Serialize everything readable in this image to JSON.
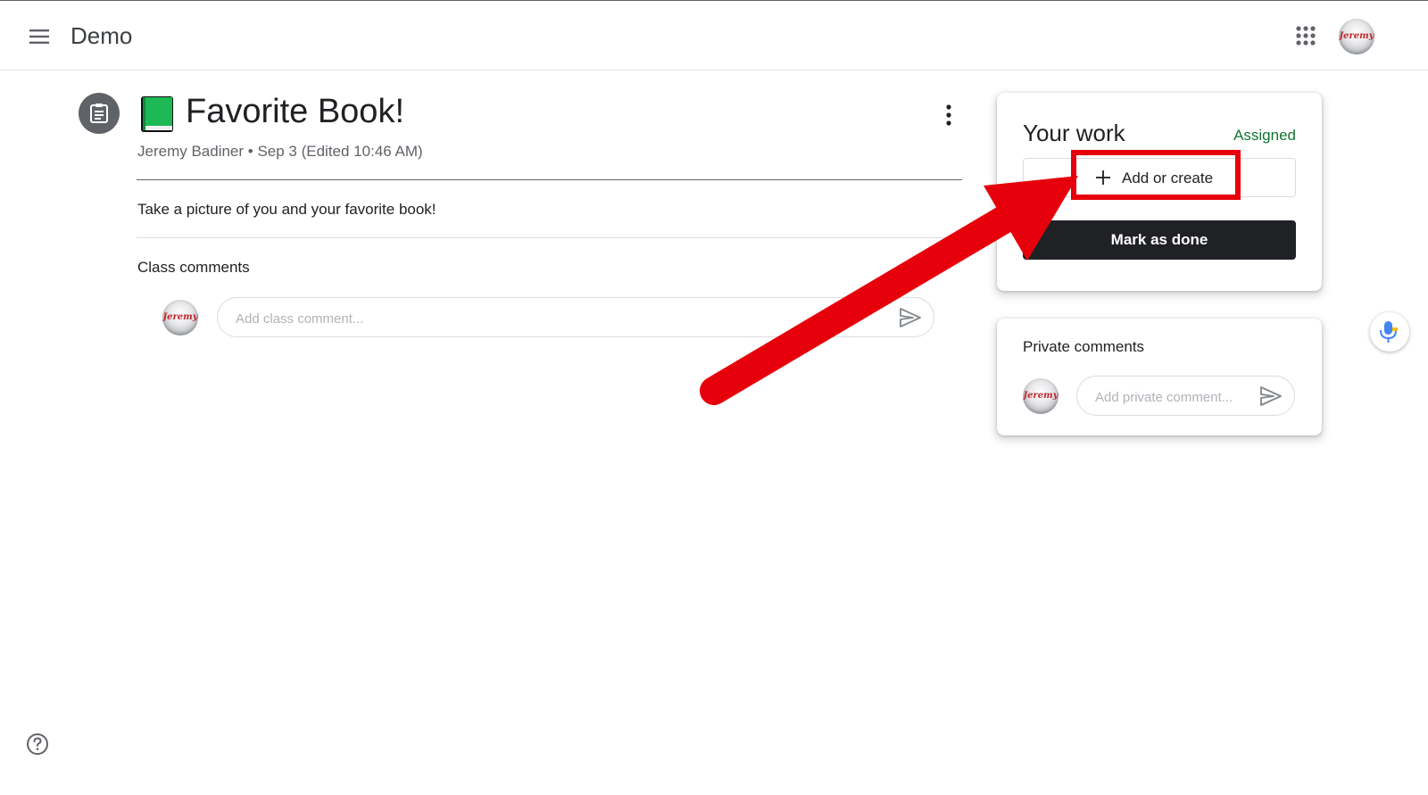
{
  "header": {
    "class_name": "Demo",
    "avatar_text": "Jeremy"
  },
  "assignment": {
    "title": "Favorite Book!",
    "meta": "Jeremy Badiner • Sep 3 (Edited 10:46 AM)",
    "instructions": "Take a picture of you and your favorite book!"
  },
  "class_comments": {
    "label": "Class comments",
    "placeholder": "Add class comment...",
    "avatar_text": "Jeremy"
  },
  "your_work": {
    "title": "Your work",
    "status": "Assigned",
    "add_label": "Add or create",
    "mark_done_label": "Mark as done"
  },
  "private_comments": {
    "label": "Private comments",
    "placeholder": "Add private comment...",
    "avatar_text": "Jeremy"
  },
  "colors": {
    "status_green": "#137333",
    "annotation_red": "#e6000b",
    "dark_button": "#202124",
    "book_green": "#1db954"
  },
  "icons": [
    "menu-icon",
    "apps-grid-icon",
    "assignment-icon",
    "green-book-icon",
    "more-vert-icon",
    "send-icon",
    "plus-icon",
    "mic-icon",
    "help-icon",
    "red-arrow-annotation"
  ]
}
